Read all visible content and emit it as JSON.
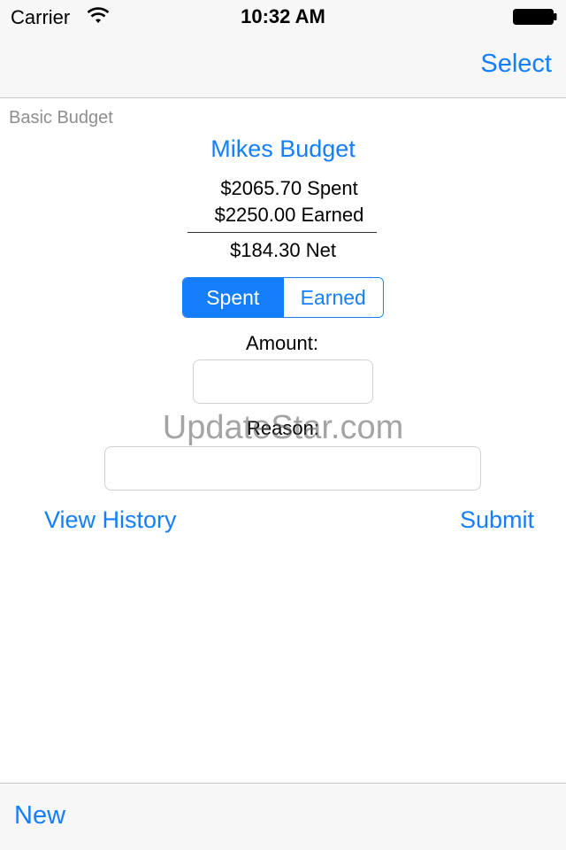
{
  "status_bar": {
    "carrier": "Carrier",
    "time": "10:32 AM",
    "wifi_icon": "wifi-icon",
    "battery_icon": "battery-icon"
  },
  "nav_bar": {
    "right_button": "Select"
  },
  "app_label": "Basic Budget",
  "budget": {
    "title": "Mikes Budget",
    "spent": "$2065.70 Spent",
    "earned": "$2250.00 Earned",
    "net": "$184.30 Net"
  },
  "segmented": {
    "options": [
      "Spent",
      "Earned"
    ],
    "selected": "Spent"
  },
  "form": {
    "amount_label": "Amount:",
    "amount_value": "",
    "reason_label": "Reason:",
    "reason_value": ""
  },
  "actions": {
    "view_history": "View History",
    "submit": "Submit"
  },
  "toolbar": {
    "new": "New"
  },
  "watermark": "UpdateStar.com",
  "colors": {
    "accent": "#147efb",
    "bar_background": "#f7f7f7",
    "secondary_text": "#8e8e8e"
  }
}
